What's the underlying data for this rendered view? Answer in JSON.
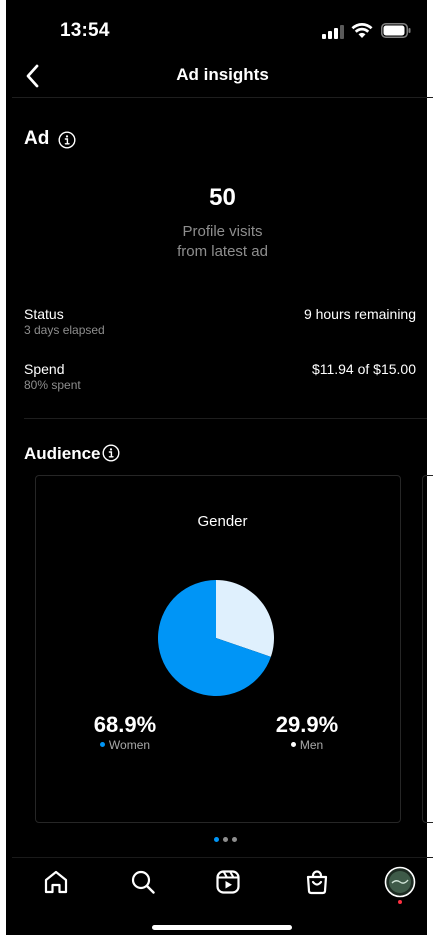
{
  "status_bar": {
    "time": "13:54"
  },
  "nav": {
    "title": "Ad insights"
  },
  "ad_section": {
    "title": "Ad",
    "metric_value": "50",
    "metric_label_line1": "Profile visits",
    "metric_label_line2": "from latest ad"
  },
  "rows": {
    "status": {
      "label": "Status",
      "sublabel": "3 days elapsed",
      "value": "9 hours remaining"
    },
    "spend": {
      "label": "Spend",
      "sublabel": "80% spent",
      "value": "$11.94 of $15.00"
    }
  },
  "audience": {
    "title": "Audience",
    "card_title": "Gender",
    "women": {
      "percent": "68.9%",
      "label": "Women",
      "color": "#0095f6"
    },
    "men": {
      "percent": "29.9%",
      "label": "Men",
      "color": "#dff0fd"
    }
  },
  "chart_data": {
    "type": "pie",
    "title": "Gender",
    "categories": [
      "Women",
      "Men"
    ],
    "values": [
      68.9,
      29.9
    ],
    "colors": [
      "#0095f6",
      "#dff0fd"
    ]
  },
  "pager": {
    "count": 3,
    "active": 0
  },
  "tabbar": {
    "items": [
      "home-icon",
      "search-icon",
      "reels-icon",
      "shop-icon",
      "profile-avatar"
    ]
  }
}
